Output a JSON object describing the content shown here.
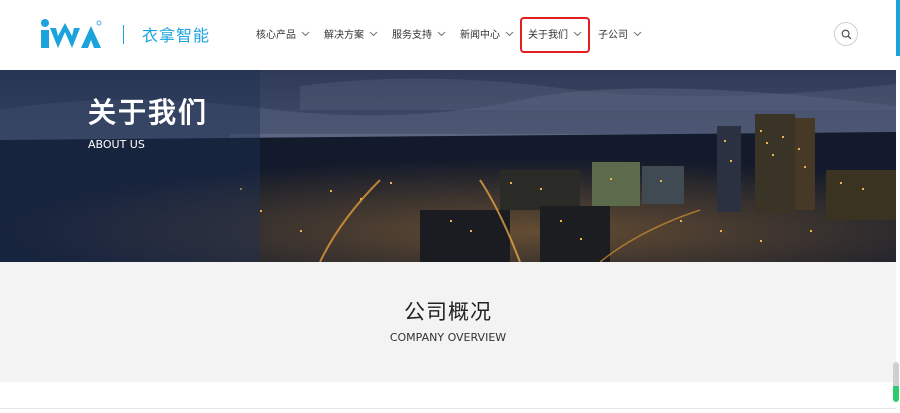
{
  "header": {
    "brand_name": "衣拿智能",
    "logo_text": "iNA",
    "nav": [
      {
        "label": "核心产品",
        "active": false
      },
      {
        "label": "解决方案",
        "active": false
      },
      {
        "label": "服务支持",
        "active": false
      },
      {
        "label": "新闻中心",
        "active": false
      },
      {
        "label": "关于我们",
        "active": true
      },
      {
        "label": "子公司",
        "active": false
      }
    ],
    "search_icon": "search-icon"
  },
  "banner": {
    "title": "关于我们",
    "subtitle": "ABOUT US"
  },
  "overview": {
    "title": "公司概况",
    "subtitle": "COMPANY OVERVIEW"
  },
  "colors": {
    "brand": "#1ba3de",
    "active_outline": "#e02020",
    "banner_dark": "#1e2a44"
  }
}
